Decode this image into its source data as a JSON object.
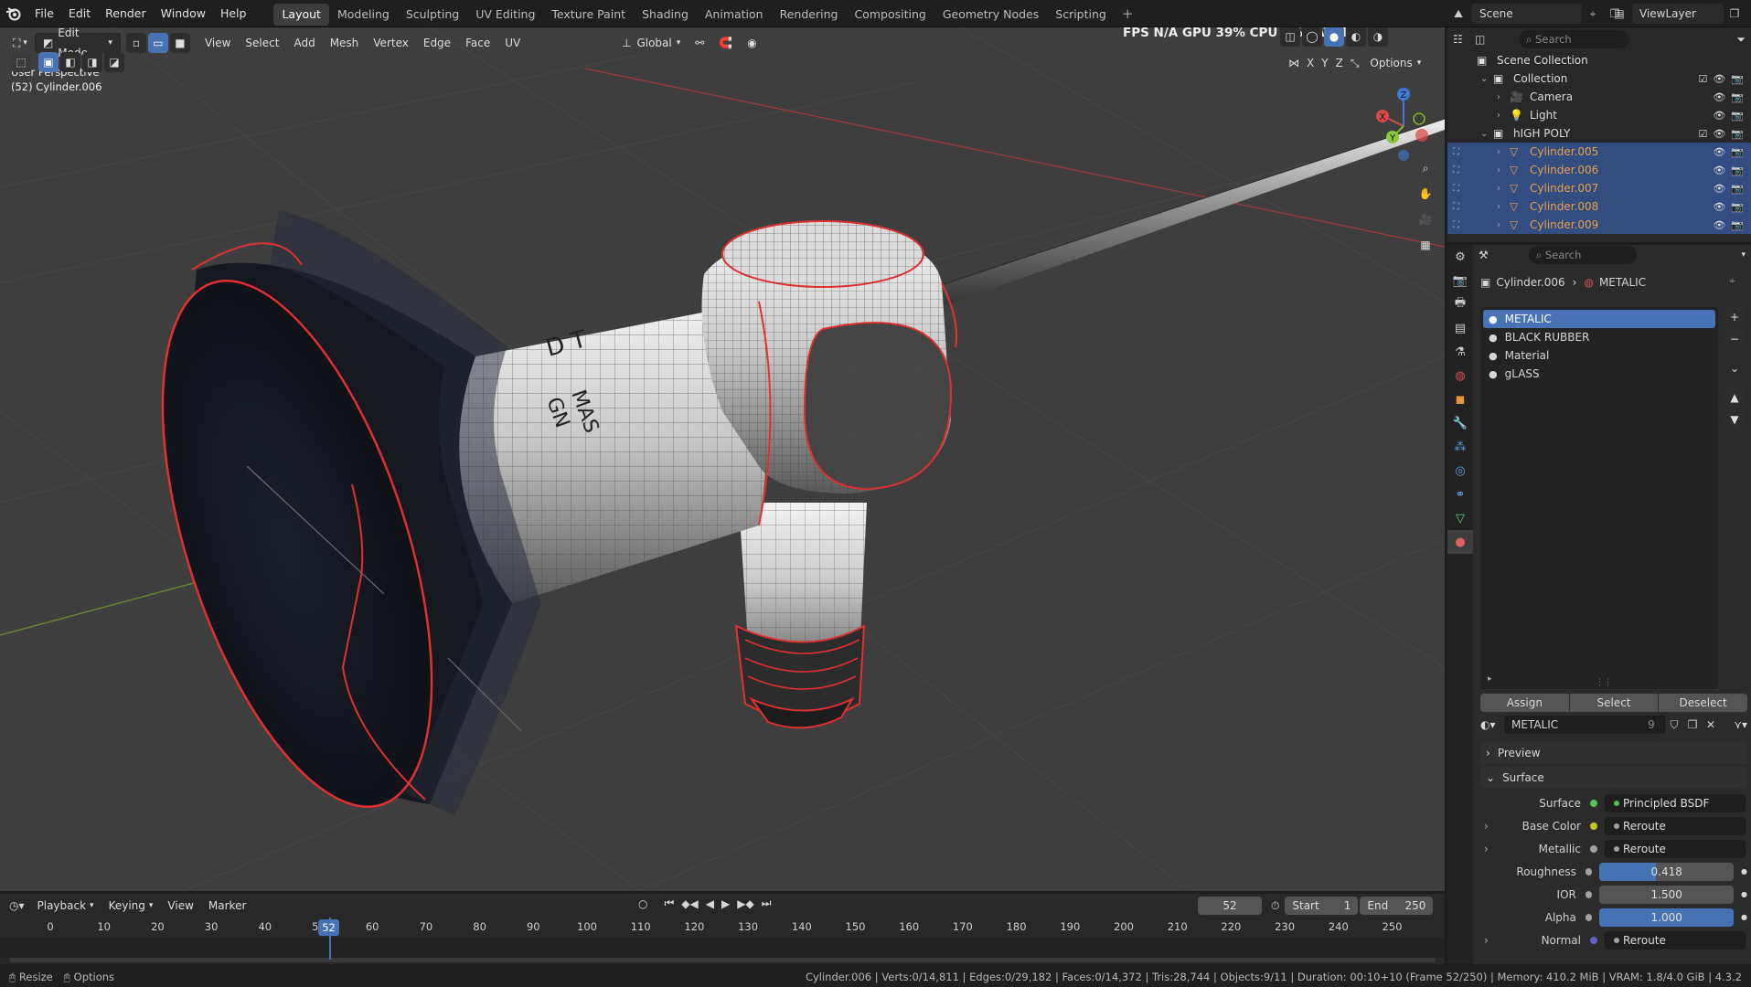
{
  "topbar": {
    "menus": [
      "File",
      "Edit",
      "Render",
      "Window",
      "Help"
    ],
    "workspaces": [
      "Layout",
      "Modeling",
      "Sculpting",
      "UV Editing",
      "Texture Paint",
      "Shading",
      "Animation",
      "Rendering",
      "Compositing",
      "Geometry Nodes",
      "Scripting"
    ],
    "active_workspace": "Layout",
    "scene_name": "Scene",
    "view_layer": "ViewLayer",
    "add_tab": "+"
  },
  "viewport": {
    "mode": "Edit Mode",
    "menus": [
      "View",
      "Select",
      "Add",
      "Mesh",
      "Vertex",
      "Edge",
      "Face",
      "UV"
    ],
    "transform_orientation": "Global",
    "overlay_title": "User Perspective",
    "overlay_object": "(52) Cylinder.006",
    "stats": "FPS N/A GPU 39% CPU 9% LAT N/A",
    "options_label": "Options",
    "axes": [
      "X",
      "Y",
      "Z"
    ],
    "gizmo_labels": {
      "x": "X",
      "y": "Y",
      "z": "Z"
    },
    "decal_text": [
      "D T",
      "MAS",
      "GN"
    ]
  },
  "outliner": {
    "search_placeholder": "Search",
    "rows": [
      {
        "label": "Scene Collection",
        "indent": 0,
        "icon": "scene-collection-icon",
        "selected": false,
        "orange": false
      },
      {
        "label": "Collection",
        "indent": 1,
        "icon": "collection-icon",
        "selected": false,
        "orange": false
      },
      {
        "label": "Camera",
        "indent": 2,
        "icon": "camera-icon",
        "selected": false,
        "orange": false
      },
      {
        "label": "Light",
        "indent": 2,
        "icon": "light-icon",
        "selected": false,
        "orange": false
      },
      {
        "label": "hIGH POLY",
        "indent": 1,
        "icon": "collection-icon",
        "selected": false,
        "orange": false
      },
      {
        "label": "Cylinder.005",
        "indent": 2,
        "icon": "mesh-icon",
        "selected": true,
        "orange": true
      },
      {
        "label": "Cylinder.006",
        "indent": 2,
        "icon": "mesh-icon",
        "selected": true,
        "orange": true
      },
      {
        "label": "Cylinder.007",
        "indent": 2,
        "icon": "mesh-icon",
        "selected": true,
        "orange": true
      },
      {
        "label": "Cylinder.008",
        "indent": 2,
        "icon": "mesh-icon",
        "selected": true,
        "orange": true
      },
      {
        "label": "Cylinder.009",
        "indent": 2,
        "icon": "mesh-icon",
        "selected": true,
        "orange": true
      }
    ]
  },
  "properties": {
    "search_placeholder": "Search",
    "breadcrumb_object": "Cylinder.006",
    "breadcrumb_material": "METALIC",
    "materials": [
      "METALIC",
      "BLACK RUBBER",
      "Material",
      "gLASS"
    ],
    "active_material": "METALIC",
    "buttons": {
      "assign": "Assign",
      "select": "Select",
      "deselect": "Deselect"
    },
    "material_name": "METALIC",
    "user_count": "9",
    "panels": {
      "preview": "Preview",
      "surface": "Surface"
    },
    "surface_rows": [
      {
        "label": "Surface",
        "value": "Principled BSDF",
        "type": "link",
        "socket": "#55c255"
      },
      {
        "label": "Base Color",
        "value": "Reroute",
        "type": "link",
        "socket": "#c7c729",
        "expand": true
      },
      {
        "label": "Metallic",
        "value": "Reroute",
        "type": "link",
        "socket": "#a1a1a1",
        "expand": true
      },
      {
        "label": "Roughness",
        "value": "0.418",
        "type": "fill",
        "socket": "#a1a1a1",
        "fraction": 0.418
      },
      {
        "label": "IOR",
        "value": "1.500",
        "type": "num",
        "socket": "#a1a1a1"
      },
      {
        "label": "Alpha",
        "value": "1.000",
        "type": "fill",
        "socket": "#a1a1a1",
        "fraction": 1.0
      },
      {
        "label": "Normal",
        "value": "Reroute",
        "type": "link",
        "socket": "#6363c7",
        "expand": true
      }
    ]
  },
  "timeline": {
    "menus": [
      "Playback",
      "Keying",
      "View",
      "Marker"
    ],
    "current_frame": "52",
    "start_label": "Start",
    "start": "1",
    "end_label": "End",
    "end": "250",
    "ticks": [
      "0",
      "10",
      "20",
      "30",
      "40",
      "50",
      "60",
      "70",
      "80",
      "90",
      "100",
      "110",
      "120",
      "130",
      "140",
      "150",
      "160",
      "170",
      "180",
      "190",
      "200",
      "210",
      "220",
      "230",
      "240",
      "250"
    ],
    "frame_value": 52
  },
  "statusbar": {
    "left_items": [
      "Resize",
      "Options"
    ],
    "info": "Cylinder.006 | Verts:0/14,811 | Edges:0/29,182 | Faces:0/14,372 | Tris:28,744 | Objects:9/11 | Duration: 00:10+10 (Frame 52/250) | Memory: 410.2 MiB | VRAM: 1.8/4.0 GiB | 4.3.2"
  },
  "colors": {
    "accent": "#4772b3",
    "selected_row": "#334d80",
    "object_orange": "#e8a048",
    "edge_red": "#e03030",
    "playhead": "#4772b3"
  }
}
